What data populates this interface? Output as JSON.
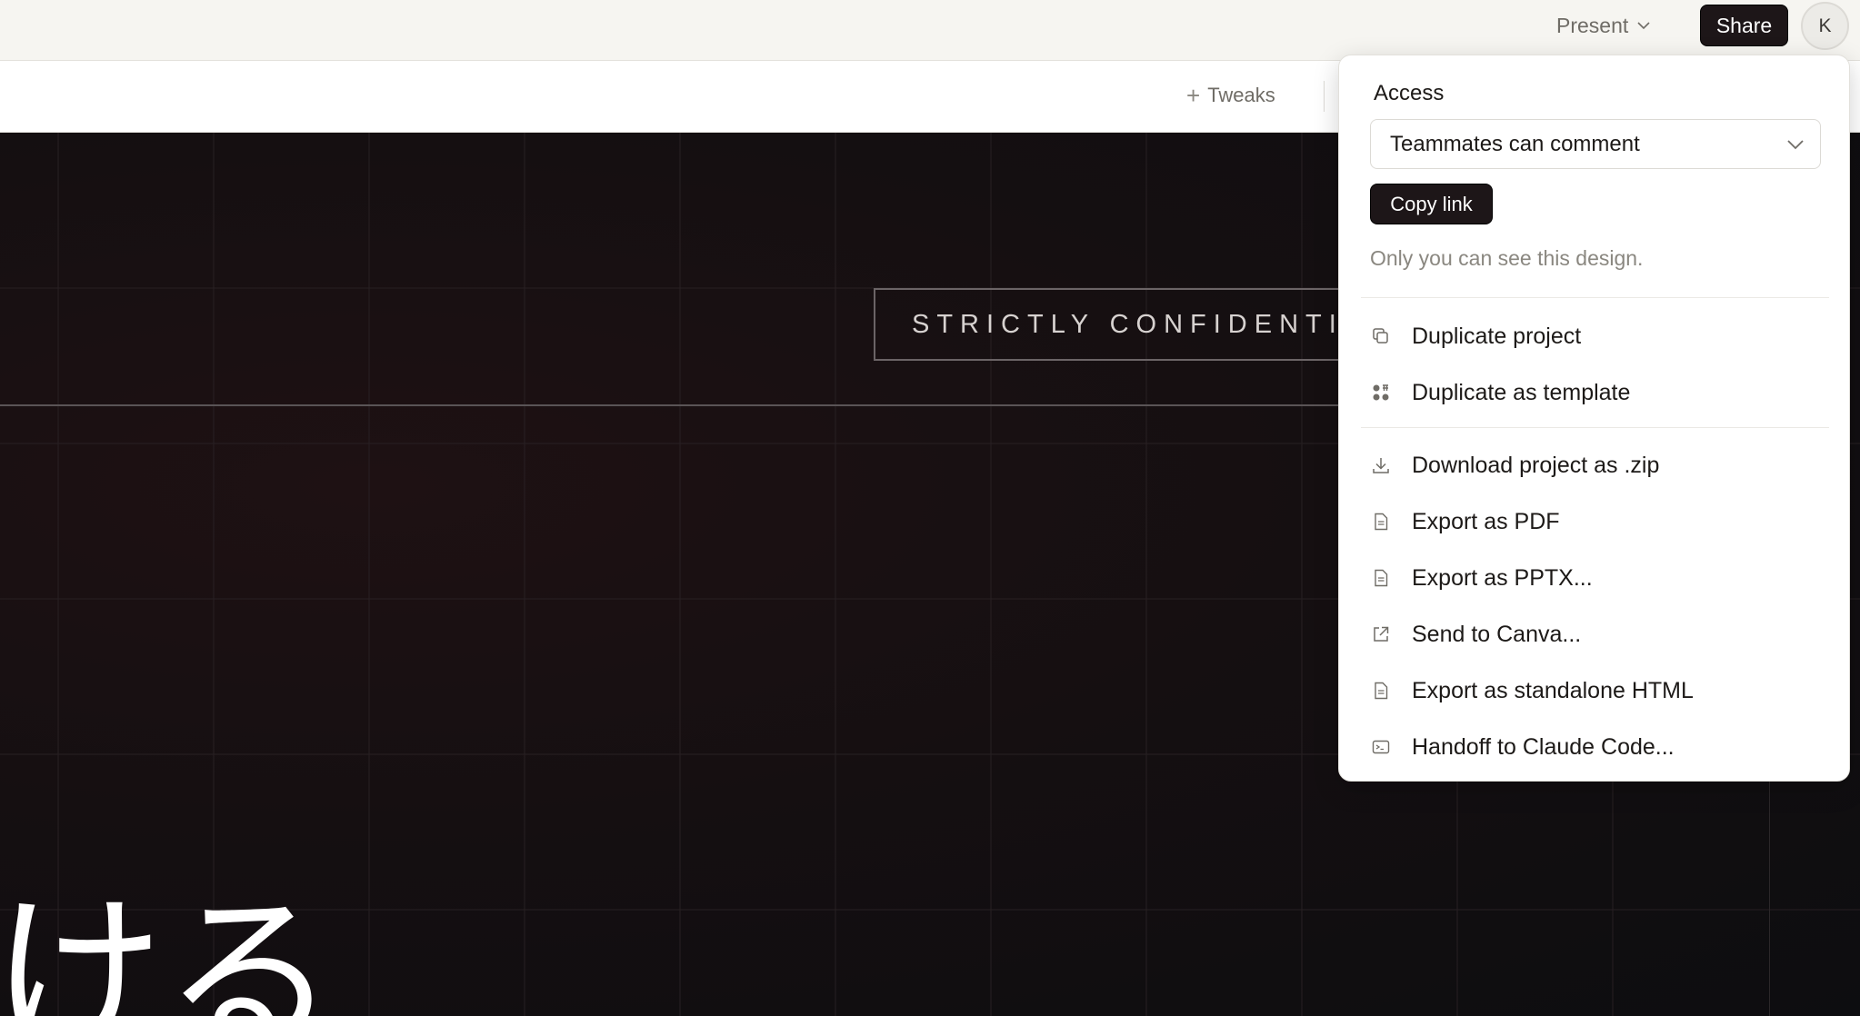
{
  "topbar": {
    "present_label": "Present",
    "share_label": "Share",
    "avatar_initial": "K"
  },
  "toolbar": {
    "tweaks_label": "Tweaks"
  },
  "canvas": {
    "confidential_text": "STRICTLY CONFIDENTIA",
    "kana_text": "ける"
  },
  "share_panel": {
    "access_label": "Access",
    "access_value": "Teammates can comment",
    "copy_link_label": "Copy link",
    "visibility_note": "Only you can see this design.",
    "items": [
      {
        "label": "Duplicate project",
        "icon": "duplicate-icon"
      },
      {
        "label": "Duplicate as template",
        "icon": "template-icon"
      },
      {
        "label": "Download project as .zip",
        "icon": "download-icon"
      },
      {
        "label": "Export as PDF",
        "icon": "file-icon"
      },
      {
        "label": "Export as PPTX...",
        "icon": "file-icon"
      },
      {
        "label": "Send to Canva...",
        "icon": "external-link-icon"
      },
      {
        "label": "Export as standalone HTML",
        "icon": "file-icon"
      },
      {
        "label": "Handoff to Claude Code...",
        "icon": "terminal-icon"
      }
    ]
  },
  "colors": {
    "topbar_bg": "#f6f5f1",
    "button_dark": "#1d1618",
    "canvas_dark": "#150f11",
    "muted_text": "#8a8780"
  }
}
